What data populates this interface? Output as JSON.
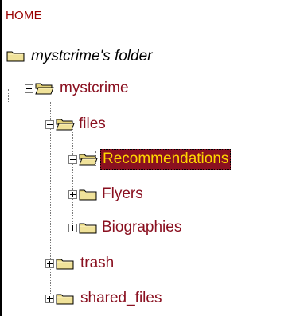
{
  "tree": {
    "home_label": "HOME",
    "root": {
      "label": "mystcrime's folder",
      "icon": "folder-icon"
    },
    "items": [
      {
        "label": "mystcrime",
        "toggle": "minus",
        "icon": "open-folder-icon"
      },
      {
        "label": "files",
        "toggle": "minus",
        "icon": "open-folder-icon"
      },
      {
        "label": "Recommendations",
        "toggle": "minus",
        "icon": "open-folder-icon",
        "selected": true
      },
      {
        "label": "Flyers",
        "toggle": "plus",
        "icon": "folder-icon"
      },
      {
        "label": "Biographies",
        "toggle": "plus",
        "icon": "folder-icon"
      },
      {
        "label": "trash",
        "toggle": "plus",
        "icon": "folder-icon"
      },
      {
        "label": "shared_files",
        "toggle": "plus",
        "icon": "folder-icon"
      }
    ]
  },
  "colors": {
    "label": "#8a1020",
    "selected_bg": "#8a1020",
    "selected_text": "#ffd700",
    "folder": "#e8d889"
  }
}
